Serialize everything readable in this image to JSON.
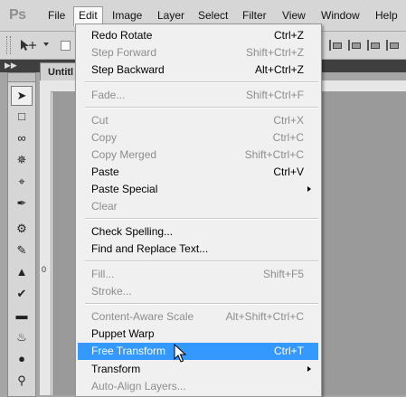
{
  "app": {
    "logo": "Ps"
  },
  "menubar": {
    "items": [
      {
        "label": "File"
      },
      {
        "label": "Edit"
      },
      {
        "label": "Image"
      },
      {
        "label": "Layer"
      },
      {
        "label": "Select"
      },
      {
        "label": "Filter"
      },
      {
        "label": "View"
      },
      {
        "label": "Window"
      },
      {
        "label": "Help"
      }
    ],
    "active": "Edit"
  },
  "document": {
    "tab_label": "Untitl",
    "ruler_mark": "0"
  },
  "edit_menu": {
    "items": [
      {
        "label": "Redo Rotate",
        "shortcut": "Ctrl+Z",
        "enabled": true
      },
      {
        "label": "Step Forward",
        "shortcut": "Shift+Ctrl+Z",
        "enabled": false
      },
      {
        "label": "Step Backward",
        "shortcut": "Alt+Ctrl+Z",
        "enabled": true
      },
      {
        "label": "Fade...",
        "shortcut": "Shift+Ctrl+F",
        "enabled": false
      },
      {
        "label": "Cut",
        "shortcut": "Ctrl+X",
        "enabled": false
      },
      {
        "label": "Copy",
        "shortcut": "Ctrl+C",
        "enabled": false
      },
      {
        "label": "Copy Merged",
        "shortcut": "Shift+Ctrl+C",
        "enabled": false
      },
      {
        "label": "Paste",
        "shortcut": "Ctrl+V",
        "enabled": true
      },
      {
        "label": "Paste Special",
        "shortcut": "",
        "enabled": true,
        "submenu": true
      },
      {
        "label": "Clear",
        "shortcut": "",
        "enabled": false
      },
      {
        "label": "Check Spelling...",
        "shortcut": "",
        "enabled": true
      },
      {
        "label": "Find and Replace Text...",
        "shortcut": "",
        "enabled": true
      },
      {
        "label": "Fill...",
        "shortcut": "Shift+F5",
        "enabled": false
      },
      {
        "label": "Stroke...",
        "shortcut": "",
        "enabled": false
      },
      {
        "label": "Content-Aware Scale",
        "shortcut": "Alt+Shift+Ctrl+C",
        "enabled": false
      },
      {
        "label": "Puppet Warp",
        "shortcut": "",
        "enabled": true
      },
      {
        "label": "Free Transform",
        "shortcut": "Ctrl+T",
        "enabled": true,
        "highlighted": true
      },
      {
        "label": "Transform",
        "shortcut": "",
        "enabled": true,
        "submenu": true
      },
      {
        "label": "Auto-Align Layers...",
        "shortcut": "",
        "enabled": false
      }
    ]
  },
  "tools": [
    "move-tool",
    "marquee-tool",
    "lasso-tool",
    "quick-select-tool",
    "crop-tool",
    "eyedropper-tool",
    "healing-brush-tool",
    "brush-tool",
    "clone-stamp-tool",
    "history-brush-tool",
    "eraser-tool",
    "paint-bucket-tool",
    "blur-tool",
    "dodge-tool",
    "pen-tool"
  ],
  "colors": {
    "highlight": "#3399ff",
    "menu_bg": "#f0f0f0",
    "disabled_text": "#8d8d8d"
  }
}
